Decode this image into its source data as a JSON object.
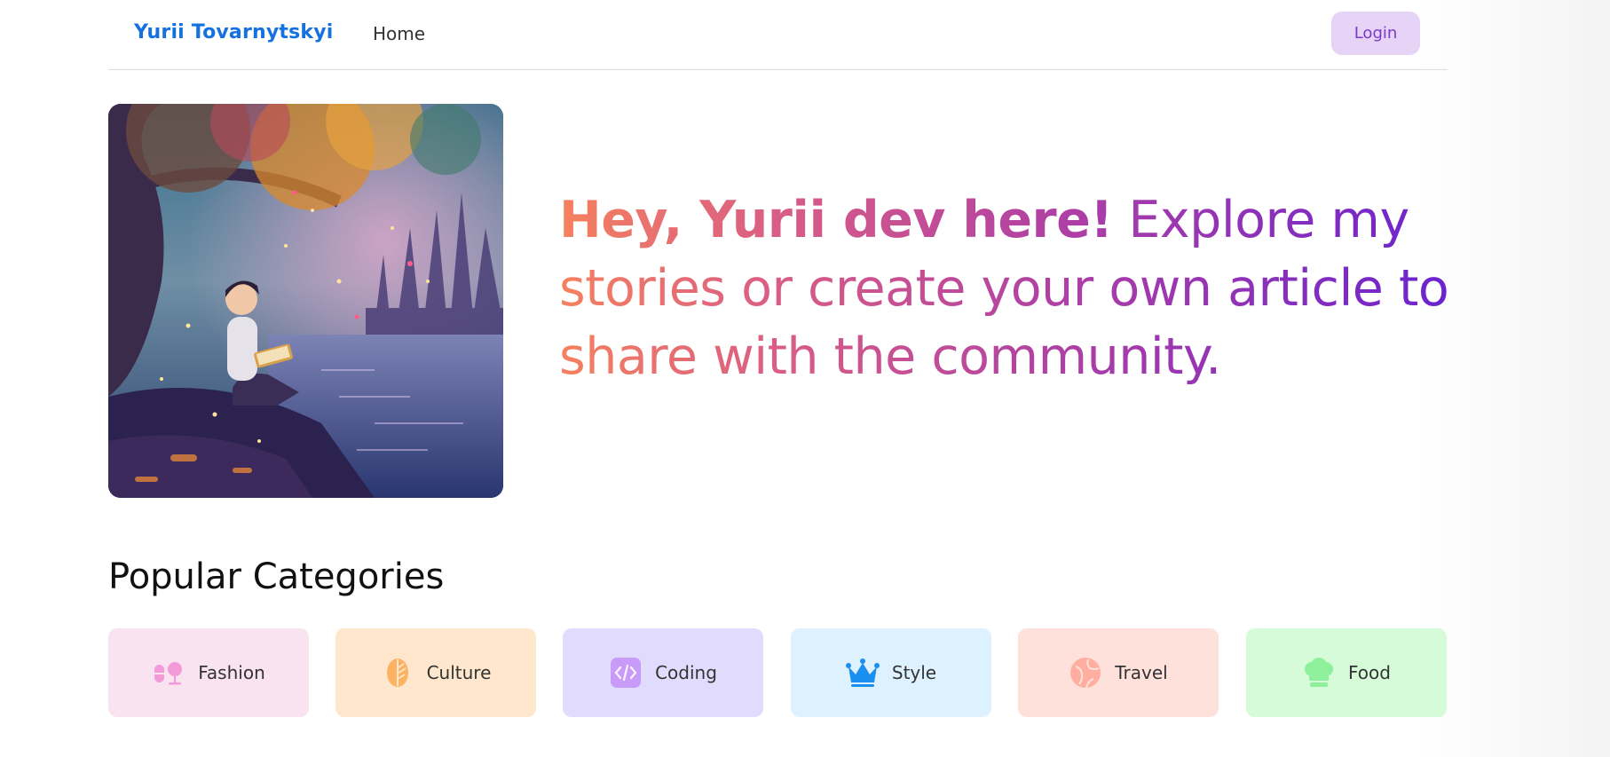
{
  "nav": {
    "brand": "Yurii Tovarnytskyi",
    "home_label": "Home",
    "login_label": "Login"
  },
  "hero": {
    "bold_text": "Hey, Yurii dev here!",
    "rest_text": " Explore my stories or create your own article to share with the community."
  },
  "categories": {
    "title": "Popular Categories",
    "items": [
      {
        "label": "Fashion",
        "icon": "fashion-icon",
        "bg": "#f9e3f1",
        "color": "#f39ad8"
      },
      {
        "label": "Culture",
        "icon": "leaf-icon",
        "bg": "#fee7cc",
        "color": "#fbb363"
      },
      {
        "label": "Coding",
        "icon": "code-icon",
        "bg": "#e1dcfd",
        "color": "#c99bf9"
      },
      {
        "label": "Style",
        "icon": "crown-icon",
        "bg": "#ddf1fe",
        "color": "#1a8ff0"
      },
      {
        "label": "Travel",
        "icon": "globe-icon",
        "bg": "#ffe1db",
        "color": "#ffae9f"
      },
      {
        "label": "Food",
        "icon": "chef-hat-icon",
        "bg": "#d6fbd9",
        "color": "#8ef09a"
      }
    ]
  }
}
